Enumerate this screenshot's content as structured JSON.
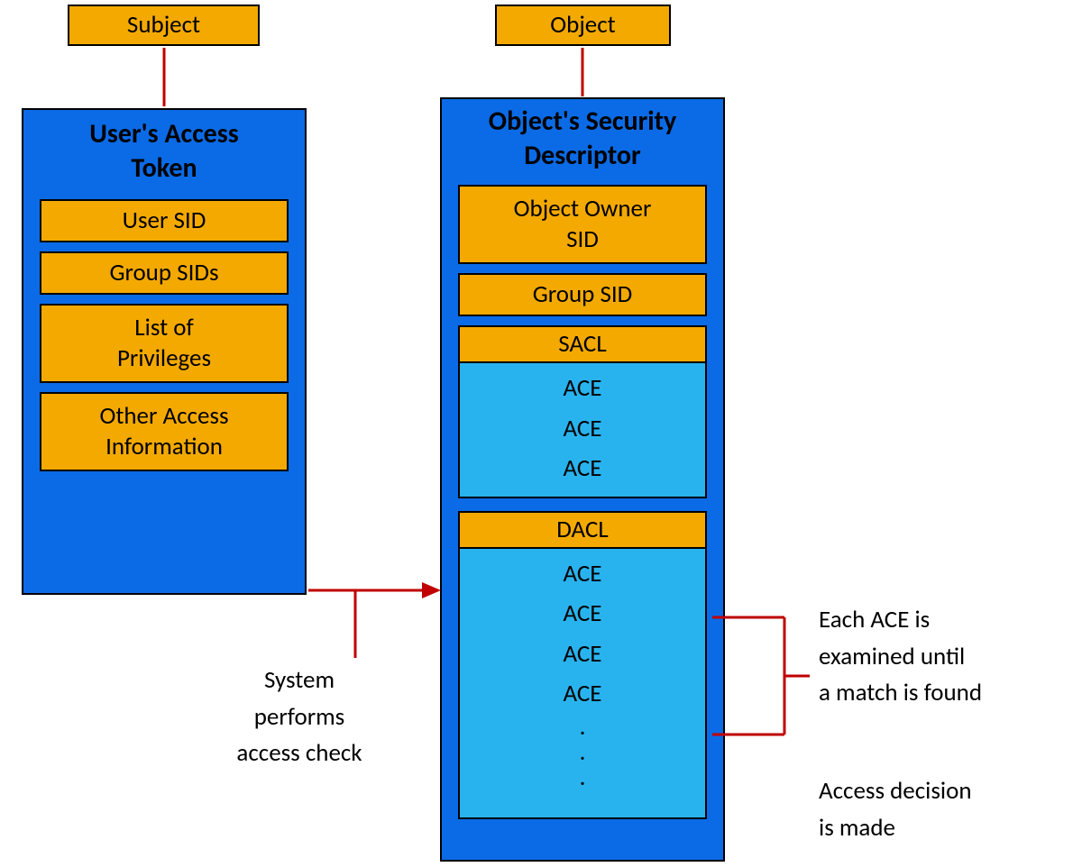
{
  "subject": {
    "label": "Subject"
  },
  "object": {
    "label": "Object"
  },
  "access_token": {
    "title_l1": "User's Access",
    "title_l2": "Token",
    "rows": {
      "user_sid": "User SID",
      "group_sids": "Group SIDs",
      "priv_l1": "List of",
      "priv_l2": "Privileges",
      "other_l1": "Other Access",
      "other_l2": "Information"
    }
  },
  "security_descriptor": {
    "title_l1": "Object's Security",
    "title_l2": "Descriptor",
    "rows": {
      "owner_l1": "Object Owner",
      "owner_l2": "SID",
      "group_sid": "Group SID",
      "sacl": "SACL",
      "sacl_entries": [
        "ACE",
        "ACE",
        "ACE"
      ],
      "dacl": "DACL",
      "dacl_entries": [
        "ACE",
        "ACE",
        "ACE",
        "ACE",
        ".",
        ".",
        "."
      ]
    }
  },
  "notes": {
    "access_check_l1": "System",
    "access_check_l2": "performs",
    "access_check_l3": "access check",
    "examined_l1": "Each ACE is",
    "examined_l2": "examined until",
    "examined_l3": "a match is found",
    "decision_l1": "Access decision",
    "decision_l2": "is made"
  }
}
